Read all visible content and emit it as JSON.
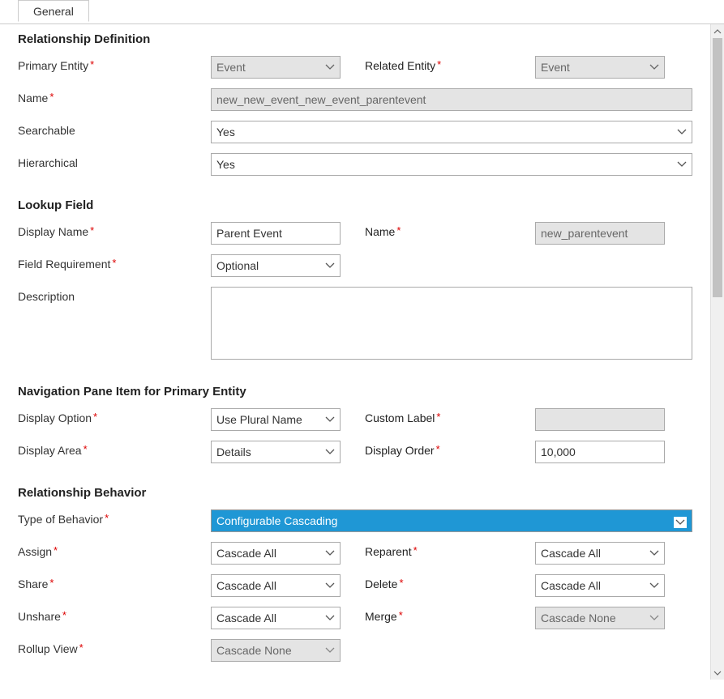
{
  "tab": {
    "label": "General"
  },
  "sections": {
    "rel_def": {
      "title": "Relationship Definition"
    },
    "lookup": {
      "title": "Lookup Field"
    },
    "nav": {
      "title": "Navigation Pane Item for Primary Entity"
    },
    "beh": {
      "title": "Relationship Behavior"
    }
  },
  "rel_def": {
    "primary_entity_label": "Primary Entity",
    "primary_entity_value": "Event",
    "related_entity_label": "Related Entity",
    "related_entity_value": "Event",
    "name_label": "Name",
    "name_value": "new_new_event_new_event_parentevent",
    "searchable_label": "Searchable",
    "searchable_value": "Yes",
    "hierarchical_label": "Hierarchical",
    "hierarchical_value": "Yes"
  },
  "lookup": {
    "display_name_label": "Display Name",
    "display_name_value": "Parent Event",
    "name_label": "Name",
    "name_value": "new_parentevent",
    "field_req_label": "Field Requirement",
    "field_req_value": "Optional",
    "description_label": "Description",
    "description_value": ""
  },
  "nav": {
    "display_option_label": "Display Option",
    "display_option_value": "Use Plural Name",
    "custom_label_label": "Custom Label",
    "custom_label_value": "",
    "display_area_label": "Display Area",
    "display_area_value": "Details",
    "display_order_label": "Display Order",
    "display_order_value": "10,000"
  },
  "beh": {
    "type_label": "Type of Behavior",
    "type_value": "Configurable Cascading",
    "assign_label": "Assign",
    "assign_value": "Cascade All",
    "reparent_label": "Reparent",
    "reparent_value": "Cascade All",
    "share_label": "Share",
    "share_value": "Cascade All",
    "delete_label": "Delete",
    "delete_value": "Cascade All",
    "unshare_label": "Unshare",
    "unshare_value": "Cascade All",
    "merge_label": "Merge",
    "merge_value": "Cascade None",
    "rollup_label": "Rollup View",
    "rollup_value": "Cascade None"
  }
}
